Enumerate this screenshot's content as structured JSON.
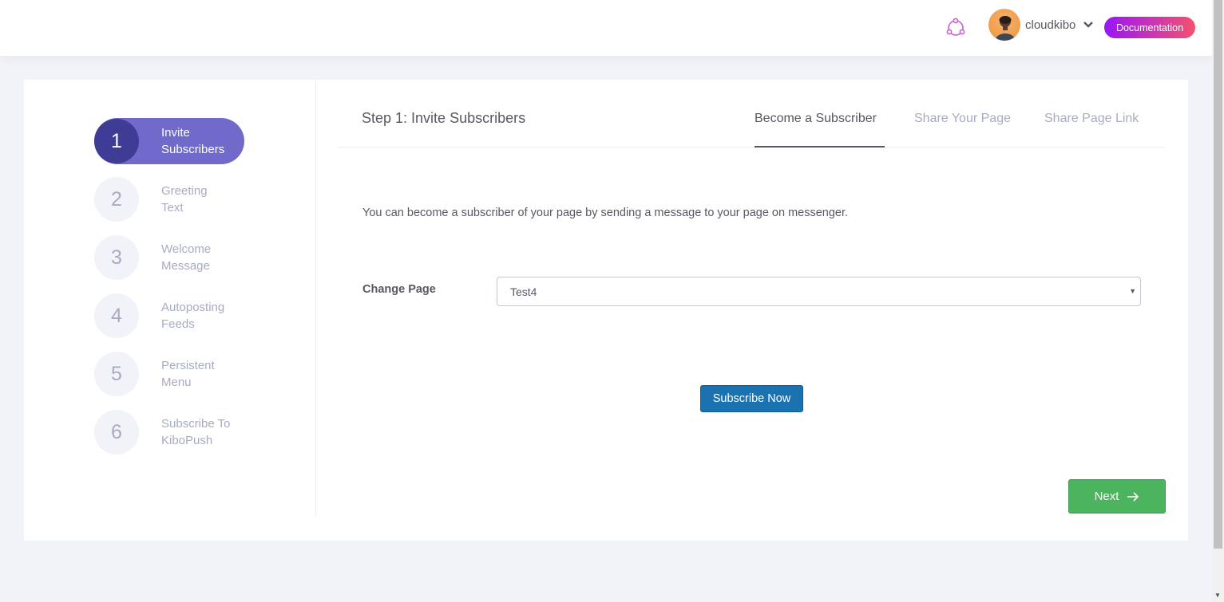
{
  "header": {
    "username": "cloudkibo",
    "documentation_label": "Documentation"
  },
  "wizard": {
    "steps": [
      {
        "number": "1",
        "label_line1": "Invite",
        "label_line2": "Subscribers",
        "active": true
      },
      {
        "number": "2",
        "label_line1": "Greeting",
        "label_line2": "Text",
        "active": false
      },
      {
        "number": "3",
        "label_line1": "Welcome",
        "label_line2": "Message",
        "active": false
      },
      {
        "number": "4",
        "label_line1": "Autoposting",
        "label_line2": "Feeds",
        "active": false
      },
      {
        "number": "5",
        "label_line1": "Persistent",
        "label_line2": "Menu",
        "active": false
      },
      {
        "number": "6",
        "label_line1": "Subscribe To",
        "label_line2": "KiboPush",
        "active": false
      }
    ]
  },
  "panel": {
    "title": "Step 1: Invite Subscribers",
    "tabs": [
      {
        "label": "Become a Subscriber",
        "active": true
      },
      {
        "label": "Share Your Page",
        "active": false
      },
      {
        "label": "Share Page Link",
        "active": false
      }
    ],
    "description": "You can become a subscriber of your page by sending a message to your page on messenger.",
    "change_page_label": "Change Page",
    "selected_page": "Test4",
    "subscribe_label": "Subscribe Now",
    "next_label": "Next"
  },
  "colors": {
    "accent": "#716aca",
    "accent_dark": "#3f3c96",
    "primary_button": "#1a73b0",
    "success_button": "#4cb45e"
  }
}
